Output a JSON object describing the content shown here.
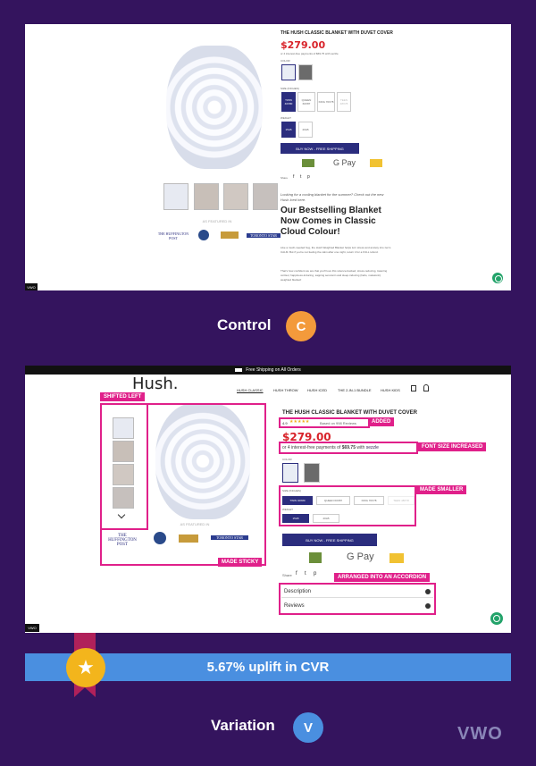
{
  "control": {
    "product_title": "THE HUSH CLASSIC BLANKET WITH DUVET COVER",
    "price": "$279.00",
    "installments": "or 4 interest-free payments of $69.75 with sezzle",
    "color_label": "COLOR",
    "size_label": "SIZE (INCHES)",
    "sizes": [
      "TWIN 40X80",
      "QUEEN 60X87",
      "KING 70X78",
      "TEEN 48X78"
    ],
    "weight_label": "WEIGHT",
    "weights": [
      "15LB",
      "20LB"
    ],
    "buy_label": "BUY NOW - FREE SHIPPING",
    "gpay": "G Pay",
    "share": "Share",
    "featured": "AS FEATURED IN",
    "huffington": "THE HUFFINGTON POST",
    "toronto": "TORONTO STAR",
    "intro": "Looking for a cooling blanket for the summer? Check out the new Hush Iced here.",
    "headline": "Our Bestselling Blanket Now Comes in Classic Cloud Colour!",
    "body1": "Like a much-needed hug, the Hush Weighted Blanket helps turn stress and anxiety into zen's CALM. But if you're not feeling the calm after one night, return it for a FULL refund.",
    "body2": "That's how confident we are that you'll love this science-backed, stress-reducing, lowering cortisol, happiness-inducing, sapping serotonin and sleep-inducing (hello, melatonin) weighted blanket!",
    "vwo": "VWO"
  },
  "control_label": "Control",
  "control_letter": "C",
  "variation": {
    "shipping_bar": "Free Shipping on All Orders",
    "logo": "Hush.",
    "nav": [
      "HUSH CLASSIC",
      "HUSH THROW",
      "HUSH ICED",
      "THE 2-IN-1 BUNDLE",
      "HUSH KIDS"
    ],
    "product_title": "THE HUSH CLASSIC BLANKET WITH DUVET COVER",
    "rating": "4.9",
    "stars": "★★★★★",
    "reviews_text": "Based on 998 Reviews",
    "price": "$279.00",
    "installments_pre": "or 4 interest-free payments of",
    "installments_amt": "$69.75",
    "installments_post": "with",
    "sezzle": "sezzle",
    "color_label": "COLOR",
    "size_label": "SIZE (INCHES)",
    "sizes": [
      "TWIN 40X80",
      "QUEEN 60X87",
      "KING 70X78",
      "TEEN 48X78"
    ],
    "weight_label": "WEIGHT",
    "weights": [
      "15LB",
      "20LB"
    ],
    "buy_label": "BUY NOW - FREE SHIPPING",
    "gpay": "G Pay",
    "share": "Share",
    "featured": "AS FEATURED IN",
    "huffington": "THE HUFFINGTON POST",
    "toronto": "TORONTO STAR",
    "accordion": [
      "Description",
      "Reviews"
    ],
    "vwo": "VWO"
  },
  "annotations": {
    "shifted_left": "SHIFTED LEFT",
    "added": "ADDED",
    "font_size": "FONT SIZE INCREASED",
    "smaller": "MADE SMALLER",
    "accordion": "ARRANGED INTO AN ACCORDION",
    "sticky": "MADE STICKY"
  },
  "uplift": "5.67% uplift in CVR",
  "variation_label": "Variation",
  "variation_letter": "V",
  "vwo_logo": "VWO",
  "colors": {
    "background": "#34145e",
    "control_circle": "#f39a3b",
    "variation_circle": "#4a8fe0",
    "uplift_bar": "#4a8fe0",
    "annotation": "#e0208a",
    "buy_button": "#2b2d7e",
    "price": "#d8232a"
  }
}
